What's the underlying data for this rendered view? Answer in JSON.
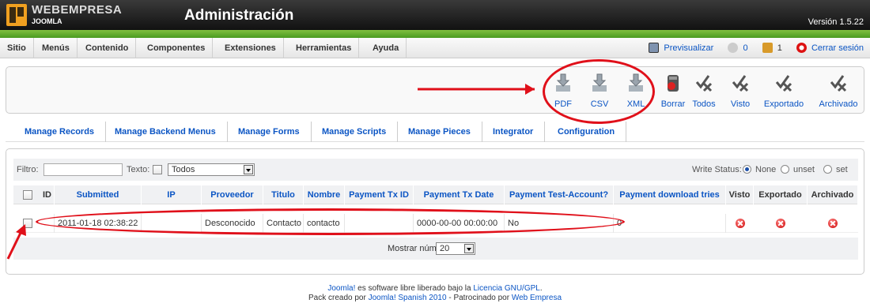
{
  "header": {
    "brand_top": "WEBEMPRESA",
    "brand_bottom": "JOOMLA",
    "title": "Administración",
    "version": "Versión 1.5.22"
  },
  "menu": {
    "items": [
      "Sitio",
      "Menús",
      "Contenido",
      "Componentes",
      "Extensiones",
      "Herramientas",
      "Ayuda"
    ],
    "preview": "Previsualizar",
    "messages_count": "0",
    "users_count": "1",
    "logout": "Cerrar sesión"
  },
  "toolbar": {
    "pdf": "PDF",
    "csv": "CSV",
    "xml": "XML",
    "delete": "Borrar",
    "all": "Todos",
    "seen": "Visto",
    "exported": "Exportado",
    "archived": "Archivado"
  },
  "submenu": {
    "items": [
      "Manage Records",
      "Manage Backend Menus",
      "Manage Forms",
      "Manage Scripts",
      "Manage Pieces",
      "Integrator",
      "Configuration"
    ]
  },
  "filters": {
    "filter_label": "Filtro:",
    "filter_value": "",
    "text_label": "Texto:",
    "form_select": "Todos",
    "write_status_label": "Write Status:",
    "radio_none": "None",
    "radio_unset": "unset",
    "radio_set": "set",
    "selected": "None"
  },
  "table": {
    "columns": [
      "ID",
      "Submitted",
      "IP",
      "Proveedor",
      "Titulo",
      "Nombre",
      "Payment Tx ID",
      "Payment Tx Date",
      "Payment Test-Account?",
      "Payment download tries",
      "Visto",
      "Exportado",
      "Archivado"
    ],
    "rows": [
      {
        "id": "",
        "submitted": "2011-01-18 02:38:22",
        "ip": "",
        "proveedor": "Desconocido",
        "titulo": "Contacto",
        "nombre": "contacto",
        "tx_id": "",
        "tx_date": "0000-00-00 00:00:00",
        "test_account": "No",
        "download_tries": "0"
      }
    ]
  },
  "pager": {
    "label": "Mostrar núm.",
    "value": "20"
  },
  "footer": {
    "line1_link1": "Joomla!",
    "line1_text": " es software libre liberado bajo la ",
    "line1_link2": "Licencia GNU/GPL",
    "line1_end": ".",
    "line2_text": "Pack creado por ",
    "line2_link1": "Joomla! Spanish 2010",
    "line2_mid": " - Patrocinado por ",
    "line2_link2": "Web Empresa"
  },
  "colors": {
    "link": "#0b55c4",
    "header": "#1a1a1a",
    "accent_green": "#6aae30",
    "annotation_red": "#e0101a"
  }
}
